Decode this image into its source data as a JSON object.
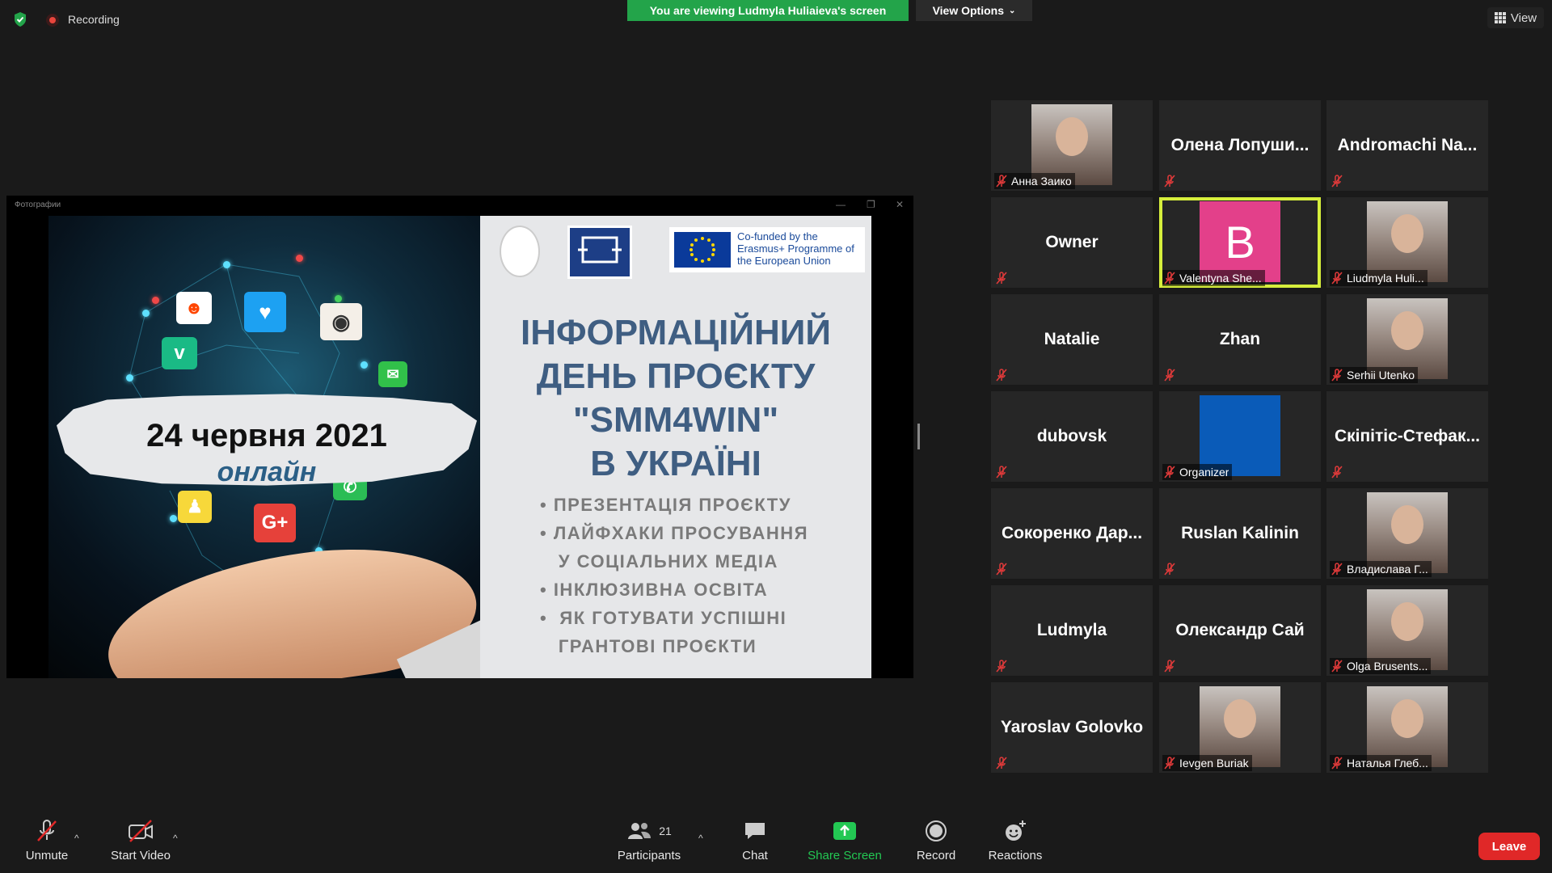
{
  "top_bar": {
    "recording_label": "Recording",
    "viewing_banner": "You are viewing Ludmyla Huliaieva's screen",
    "view_options_label": "View Options",
    "view_label": "View"
  },
  "shared_window": {
    "title": "Фотографии",
    "slide": {
      "date": "24 червня 2021",
      "online": "онлайн",
      "eu_text": "Co-funded by the Erasmus+ Programme of the European Union",
      "title_lines": [
        "ІНФОРМАЦІЙНИЙ",
        "ДЕНЬ ПРОЄКТУ",
        "\"SMM4WIN\"",
        "В УКРАЇНІ"
      ],
      "bullets": [
        "• ПРЕЗЕНТАЦІЯ ПРОЄКТУ",
        "• ЛАЙФХАКИ ПРОСУВАННЯ",
        "   У СОЦІАЛЬНИХ МЕДІА",
        "• ІНКЛЮЗИВНА ОСВІТА",
        "•  ЯК ГОТУВАТИ УСПІШНІ",
        "   ГРАНТОВІ ПРОЄКТИ"
      ]
    }
  },
  "gallery": {
    "tiles": [
      {
        "name": "Анна Заико",
        "display": "photo"
      },
      {
        "name": "Олена Лопуши...",
        "display": "name"
      },
      {
        "name": "Andromachi Na...",
        "display": "name"
      },
      {
        "name": "Owner",
        "display": "name"
      },
      {
        "name": "Valentyna She...",
        "display": "avatar",
        "avatar_letter": "B",
        "active": true
      },
      {
        "name": "Liudmyla Huli...",
        "display": "photo"
      },
      {
        "name": "Natalie",
        "display": "name"
      },
      {
        "name": "Zhan",
        "display": "name"
      },
      {
        "name": "Serhii Utenko",
        "display": "photo"
      },
      {
        "name": "dubovsk",
        "display": "name"
      },
      {
        "name": "Organizer",
        "display": "blue"
      },
      {
        "name": "Скіпітіс-Стефак...",
        "display": "name"
      },
      {
        "name": "Сокоренко Дар...",
        "display": "name"
      },
      {
        "name": "Ruslan Kalinin",
        "display": "name"
      },
      {
        "name": "Владислава Г...",
        "display": "photo"
      },
      {
        "name": "Ludmyla",
        "display": "name"
      },
      {
        "name": "Олександр Сай",
        "display": "name"
      },
      {
        "name": "Olga Brusents...",
        "display": "photo"
      },
      {
        "name": "Yaroslav Golovko",
        "display": "name"
      },
      {
        "name": "Ievgen Buriak",
        "display": "photo"
      },
      {
        "name": "Наталья Глеб...",
        "display": "photo"
      }
    ]
  },
  "toolbar": {
    "unmute": "Unmute",
    "start_video": "Start Video",
    "participants": "Participants",
    "participants_count": "21",
    "chat": "Chat",
    "share_screen": "Share Screen",
    "record": "Record",
    "reactions": "Reactions",
    "leave": "Leave"
  },
  "colors": {
    "banner_green": "#23a44a",
    "active_speaker": "#d6ee3c",
    "leave_red": "#e02828",
    "share_green": "#23c853"
  }
}
